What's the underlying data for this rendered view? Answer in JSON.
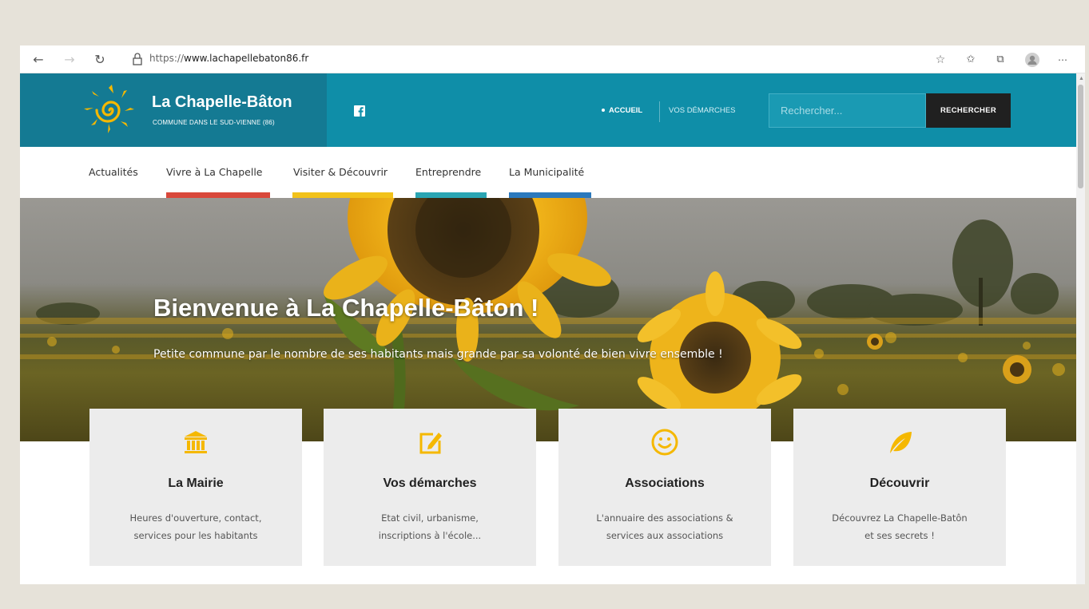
{
  "browser": {
    "url_protocol": "https://",
    "url_host": "www.lachapellebaton86.fr",
    "icons": [
      "back-icon",
      "forward-icon",
      "refresh-icon",
      "lock-icon",
      "favorite-star-icon",
      "favorites-icon",
      "collections-icon",
      "profile-icon",
      "more-icon"
    ]
  },
  "header": {
    "site_name": "La Chapelle-Bâton",
    "tagline": "COMMUNE DANS LE SUD-VIENNE (86)",
    "nav": {
      "accueil": "ACCUEIL",
      "demarches": "VOS DÉMARCHES"
    },
    "search": {
      "placeholder": "Rechercher...",
      "button": "RECHERCHER"
    },
    "colors": {
      "teal": "#0f8ea8",
      "logo_bg": "#147a93",
      "sun": "#f5b800"
    }
  },
  "main_nav": {
    "items": [
      {
        "label": "Actualités",
        "bar_color": ""
      },
      {
        "label": "Vivre à La Chapelle",
        "bar_color": "#d9483b"
      },
      {
        "label": "Visiter & Découvrir",
        "bar_color": "#f2c21a"
      },
      {
        "label": "Entreprendre",
        "bar_color": "#2aa5b3"
      },
      {
        "label": "La Municipalité",
        "bar_color": "#2b79bd"
      }
    ]
  },
  "hero": {
    "title": "Bienvenue à La Chapelle-Bâton !",
    "subtitle": "Petite commune par le nombre de ses habitants mais grande par sa volonté de bien vivre ensemble !"
  },
  "cards": [
    {
      "icon": "town-hall-icon",
      "title": "La Mairie",
      "desc_line1": "Heures d'ouverture, contact,",
      "desc_line2": "services pour les habitants"
    },
    {
      "icon": "edit-form-icon",
      "title": "Vos démarches",
      "desc_line1": "Etat civil, urbanisme,",
      "desc_line2": "inscriptions à l'école..."
    },
    {
      "icon": "smiley-icon",
      "title": "Associations",
      "desc_line1": "L'annuaire des associations &",
      "desc_line2": "services aux associations"
    },
    {
      "icon": "leaf-icon",
      "title": "Découvrir",
      "desc_line1": "Découvrez La Chapelle-Batôn",
      "desc_line2": "et ses secrets !"
    }
  ]
}
